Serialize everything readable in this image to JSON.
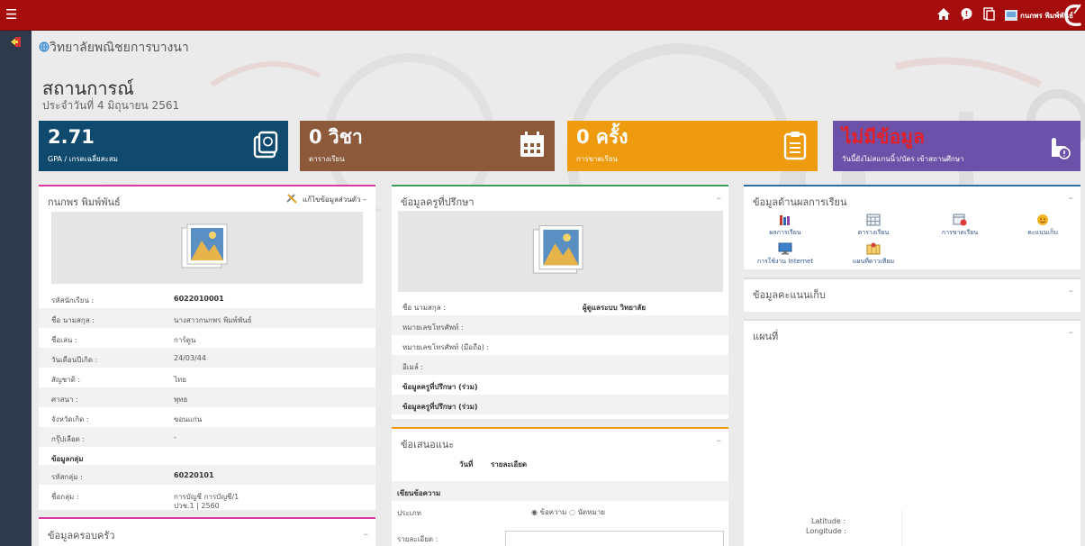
{
  "topbar": {
    "menu_icon": "hamburger-icon",
    "icons": [
      "home-icon",
      "chat-icon",
      "copy-icon"
    ],
    "user_name": "กนกพร พิมพ์พันธ์",
    "logo_icon": "brand-logo"
  },
  "header": {
    "school": "วิทยาลัยพณิชยการบางนา",
    "title": "สถานการณ์",
    "date": "ประจำวันที่ 4 มิถุนายน 2561"
  },
  "stats": [
    {
      "big": "2.71",
      "small": "GPA / เกรดเฉลี่ยสะสม",
      "color": "#0f4a6e",
      "icon": "grade-card-icon"
    },
    {
      "big": "0 วิชา",
      "small": "ตารางเรียน",
      "color": "#8c5a3b",
      "icon": "calendar-icon"
    },
    {
      "big": "0 ครั้ง",
      "small": "การขาดเรียน",
      "color": "#ef9b0f",
      "icon": "clipboard-icon"
    },
    {
      "big": "ไม่มีข้อมูล",
      "small": "วันนี้ยังไม่สแกนนิ้ว/บัตร เข้าสถานศึกษา",
      "color": "#6b52a8",
      "icon": "hand-touch-icon"
    }
  ],
  "student_panel": {
    "title": "กนกพร พิมพ์พันธ์",
    "edit_label": "แก้ไขข้อมูลส่วนตัว",
    "rows": [
      {
        "k": "รหัสนักเรียน :",
        "v": "6022010001"
      },
      {
        "k": "ชื่อ นามสกุล :",
        "v": "นางสาวกนกพร พิมพ์พันธ์"
      },
      {
        "k": "ชื่อเล่น :",
        "v": "การ์ตูน"
      },
      {
        "k": "วันเดือนปีเกิด :",
        "v": "24/03/44"
      },
      {
        "k": "สัญชาติ :",
        "v": "ไทย"
      },
      {
        "k": "ศาสนา :",
        "v": "พุทธ"
      },
      {
        "k": "จังหวัดเกิด :",
        "v": "ขอนแก่น"
      },
      {
        "k": "กรุ๊ปเลือด :",
        "v": "-"
      }
    ],
    "group_heading": "ข้อมูลกลุ่ม",
    "group_rows": [
      {
        "k": "รหัสกลุ่ม :",
        "v": "60220101"
      },
      {
        "k": "ชื่อกลุ่ม :",
        "v": "การบัญชี การบัญชี/1",
        "v2": "ปวช.1 | 2560"
      }
    ]
  },
  "family_panel": {
    "title": "ข้อมูลครอบครัว"
  },
  "advisor_panel": {
    "title": "ข้อมูลครูที่ปรึกษา",
    "rows": [
      {
        "k": "ชื่อ นามสกุล :",
        "v": "ผู้ดูแลระบบ วิทยาลัย"
      },
      {
        "k": "หมายเลขโทรศัพท์ :",
        "v": ""
      },
      {
        "k": "หมายเลขโทรศัพท์ (มือถือ) :",
        "v": ""
      },
      {
        "k": "อีเมล์ :",
        "v": ""
      },
      {
        "k": "ข้อมูลครูที่ปรึกษา (ร่วม)",
        "v": ""
      },
      {
        "k": "ข้อมูลครูที่ปรึกษา (ร่วม)",
        "v": ""
      }
    ]
  },
  "suggest_panel": {
    "title": "ข้อเสนอแนะ",
    "col_date": "วันที่",
    "col_detail": "รายละเอียด",
    "write_heading": "เขียนข้อความ",
    "type_label": "ประเภท",
    "option_message": "ข้อความ",
    "option_appointment": "นัดหมาย",
    "detail_label": "รายละเอียด :"
  },
  "study_panel": {
    "title": "ข้อมูลด้านผลการเรียน",
    "shortcuts": [
      {
        "label": "ผลการเรียน",
        "icon": "books-icon"
      },
      {
        "label": "ตารางเรียน",
        "icon": "timetable-icon"
      },
      {
        "label": "การขาดเรียน",
        "icon": "absence-calendar-icon"
      },
      {
        "label": "คะแนนเก็บ",
        "icon": "smiley-icon"
      },
      {
        "label": "การใช้งาน Internet",
        "icon": "monitor-icon"
      },
      {
        "label": "แผนที่ดาวเทียม",
        "icon": "map-icon"
      }
    ]
  },
  "score_panel": {
    "title": "ข้อมูลคะแนนเก็บ"
  },
  "map_panel": {
    "title": "แผนที่",
    "lat_label": "Latitude :",
    "lng_label": "Longitude :"
  },
  "colors": {
    "topbar": "#a50d0d",
    "sidebar": "#2e3a4c",
    "advisor_border": "#3e9a5e",
    "student_border": "#d93a9f",
    "study_border": "#2f6ea5",
    "suggest_border": "#ef9b0f"
  }
}
